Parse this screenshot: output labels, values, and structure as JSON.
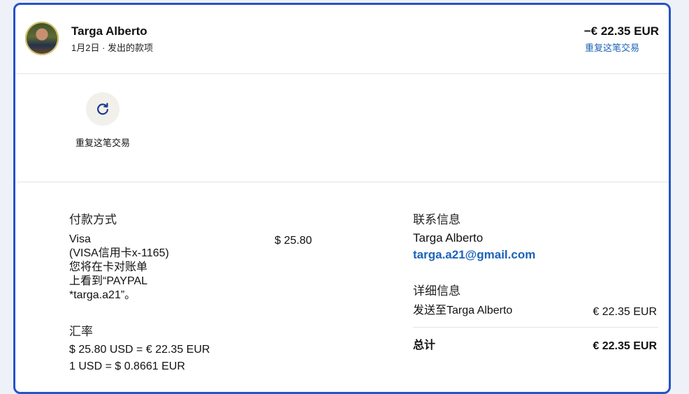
{
  "header": {
    "name": "Targa Alberto",
    "subtitle": "1月2日 · 发出的款项",
    "amount": "−€ 22.35 EUR",
    "repeat_link": "重复这笔交易"
  },
  "actions": {
    "repeat_label": "重复这笔交易"
  },
  "payment": {
    "title": "付款方式",
    "method_line1": "Visa",
    "method_line2": "(VISA信用卡x-1165)",
    "method_line3": "您将在卡对账单",
    "method_line4": "上看到“PAYPAL",
    "method_line5": "*targa.a21”。",
    "amount": "$ 25.80"
  },
  "exchange": {
    "title": "汇率",
    "line1": "$ 25.80 USD = € 22.35 EUR",
    "line2": "1 USD = $ 0.8661 EUR"
  },
  "contact": {
    "title": "联系信息",
    "name": "Targa Alberto",
    "email": "targa.a21@gmail.com"
  },
  "details": {
    "title": "详细信息",
    "sent_to": "发送至Targa Alberto",
    "sent_amount": "€ 22.35 EUR",
    "total_label": "总计",
    "total_amount": "€ 22.35 EUR"
  },
  "colors": {
    "accent": "#2553c8",
    "link": "#1c63b7"
  },
  "icons": {
    "repeat": "refresh-icon"
  }
}
